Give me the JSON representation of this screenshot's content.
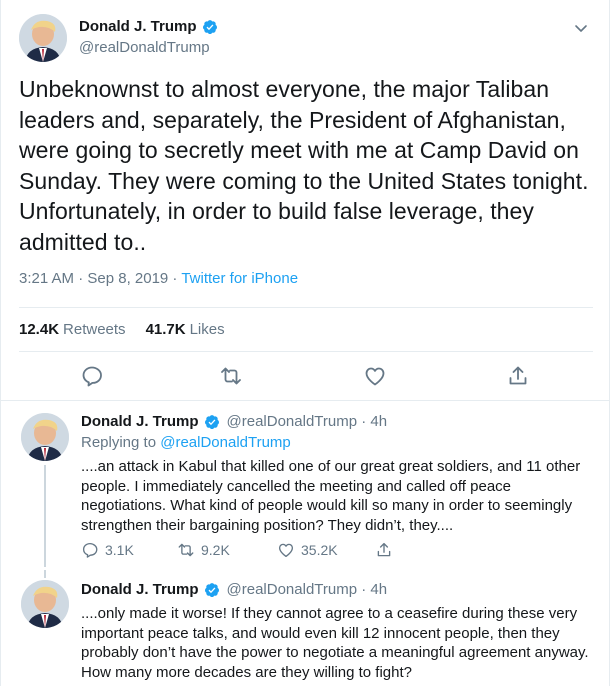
{
  "colors": {
    "accent": "#1da1f2",
    "muted": "#657786",
    "text": "#14171a",
    "border": "#e6ecf0"
  },
  "main_tweet": {
    "author_name": "Donald J. Trump",
    "author_handle": "@realDonaldTrump",
    "text": "Unbeknownst to almost everyone, the major Taliban leaders and, separately, the President of Afghanistan, were going to secretly meet with me at Camp David on Sunday. They were coming to the United States tonight. Unfortunately, in order to build false leverage, they admitted to..",
    "time": "3:21 AM · Sep 8, 2019 · ",
    "source": "Twitter for iPhone",
    "retweets_count": "12.4K",
    "retweets_label": "Retweets",
    "likes_count": "41.7K",
    "likes_label": "Likes",
    "icons": [
      "reply-icon",
      "retweet-icon",
      "like-icon",
      "share-icon"
    ]
  },
  "replies": [
    {
      "author_name": "Donald J. Trump",
      "author_handle": "@realDonaldTrump · 4h",
      "replying_prefix": "Replying to ",
      "replying_to": "@realDonaldTrump",
      "text": "....an attack in Kabul that killed one of our great great soldiers, and 11 other people. I immediately cancelled the meeting and called off peace negotiations. What kind of people would kill so many in order to seemingly strengthen their bargaining position? They didn’t, they....",
      "reply_count": "3.1K",
      "retweet_count": "9.2K",
      "like_count": "35.2K"
    },
    {
      "author_name": "Donald J. Trump",
      "author_handle": "@realDonaldTrump · 4h",
      "text": "....only made it worse! If they cannot agree to a ceasefire during these very important peace talks, and would even kill 12 innocent people, then they probably don’t have the power to negotiate a meaningful agreement anyway. How many more decades are they willing to fight?"
    }
  ]
}
